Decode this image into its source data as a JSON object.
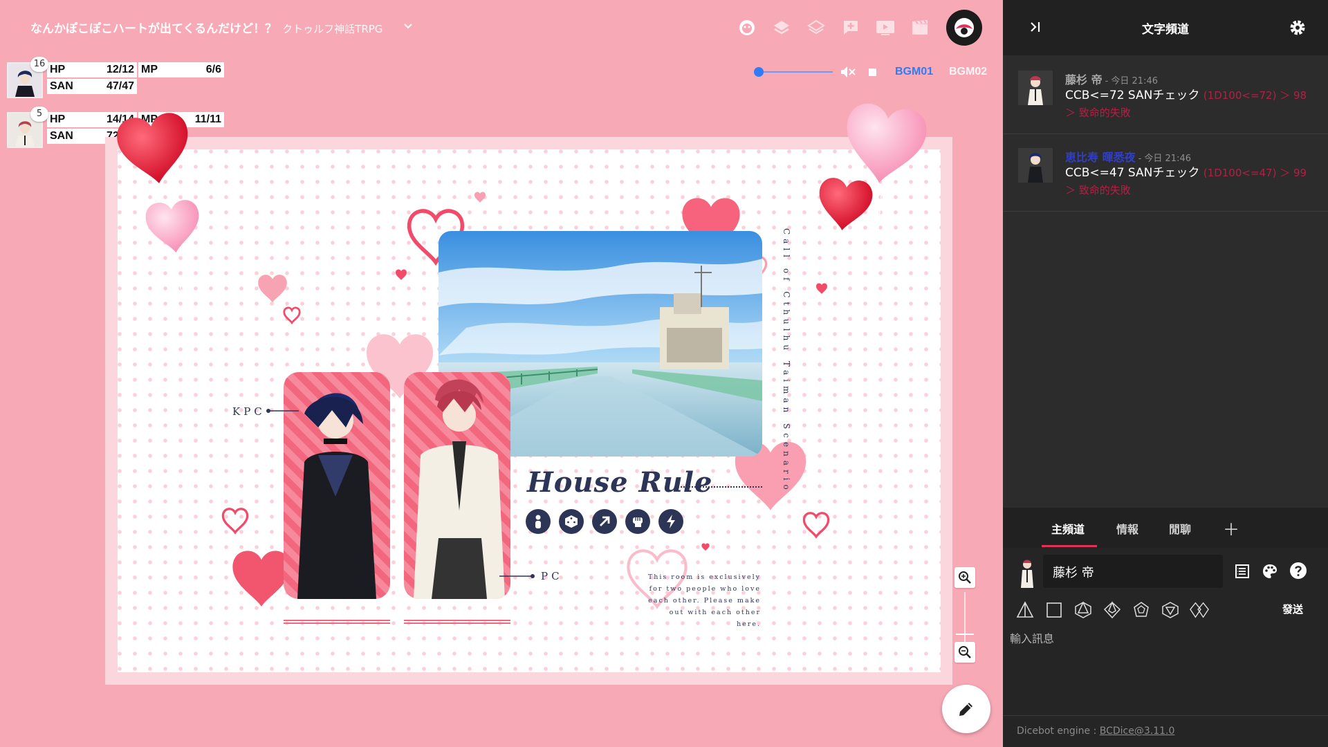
{
  "room": {
    "title": "なんかぽこぽこハートが出てくるんだけど！？",
    "subtitle": "クトゥルフ神話TRPG"
  },
  "toolbar": {
    "icons": [
      "face-icon",
      "layers-icon",
      "layers-outline-icon",
      "add-comment-icon",
      "video-icon",
      "clapperboard-icon"
    ]
  },
  "characters": [
    {
      "badge": "16",
      "hp_label": "HP",
      "hp": "12/12",
      "hp_level": 1.0,
      "mp_label": "MP",
      "mp": "6/6",
      "mp_level": 1.0,
      "san_label": "SAN",
      "san": "47/47",
      "san_level": 1.0
    },
    {
      "badge": "5",
      "hp_label": "HP",
      "hp": "14/14",
      "hp_level": 1.0,
      "mp_label": "MP",
      "mp": "11/11",
      "mp_level": 1.0,
      "san_label": "SAN",
      "san": "72/72",
      "san_level": 1.0
    }
  ],
  "audio": {
    "volume_level": 0.0,
    "bgm1": "BGM01",
    "bgm2": "BGM02"
  },
  "scene": {
    "house_rule": "House Rule",
    "vertical": "Call of Cthulhu Taiman Scenario",
    "kpc": "KPC",
    "pc": "PC",
    "note": "This room is exclusively for two people who love each other. Please make out with each other here."
  },
  "chat": {
    "title": "文字頻道",
    "messages": [
      {
        "name": "藤杉 帝",
        "name_color": "#a9a9a9",
        "time": "- 今日 21:46",
        "text": "CCB<=72 SANチェック",
        "result": "(1D100<=72) ＞ 98 ＞ 致命的失敗"
      },
      {
        "name": "恵比寿 暉悉夜",
        "name_color": "#2f3fc9",
        "time": "- 今日 21:46",
        "text": "CCB<=47 SANチェック",
        "result": "(1D100<=47) ＞ 99 ＞ 致命的失敗"
      }
    ],
    "tabs": {
      "main": "主頻道",
      "info": "情報",
      "chat": "閒聊",
      "add": "＋"
    },
    "speaker": "藤杉 帝",
    "send": "發送",
    "input_placeholder": "輸入訊息",
    "footer_prefix": "Dicebot engine : ",
    "footer_link": "BCDice@3.11.0"
  },
  "colors": {
    "stage_bg": "#f8a9b6",
    "accent_pink": "#e0325a",
    "bgm_active": "#2f7cf6",
    "dice_fail": "#b81e44",
    "navy": "#2d3557"
  }
}
